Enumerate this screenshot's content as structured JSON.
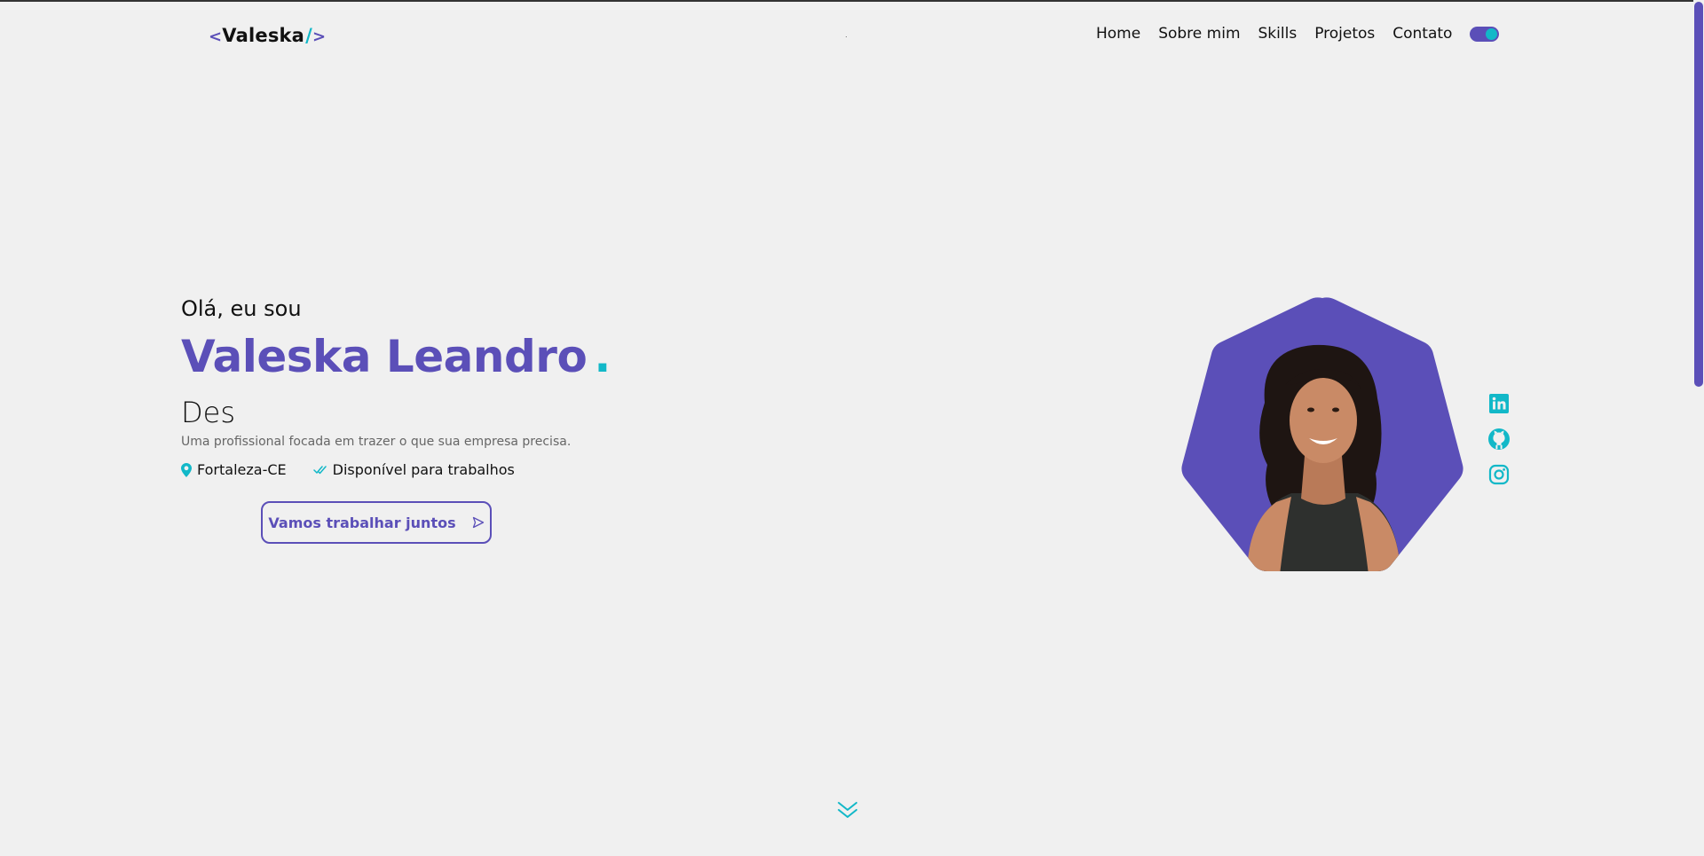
{
  "brand": {
    "open_bracket": "<",
    "name": "Valeska",
    "slash": "/",
    "close_bracket": ">",
    "accent_color": "#5b4fb8",
    "secondary_color": "#12b8c8"
  },
  "nav": {
    "items": [
      {
        "label": "Home"
      },
      {
        "label": "Sobre mim"
      },
      {
        "label": "Skills"
      },
      {
        "label": "Projetos"
      },
      {
        "label": "Contato"
      }
    ],
    "theme_toggle": {
      "state": "on",
      "icon": "toggle-icon"
    }
  },
  "hero": {
    "greeting": "Olá, eu sou",
    "name": "Valeska Leandro",
    "name_dot": ".",
    "role_typed": "Des",
    "tagline": "Uma profissional focada em trazer o que sua empresa precisa.",
    "location": {
      "icon": "map-pin-icon",
      "text": "Fortaleza-CE"
    },
    "availability": {
      "icon": "double-check-icon",
      "text": "Disponível para trabalhos"
    },
    "cta": {
      "label": "Vamos trabalhar juntos",
      "icon": "send-icon"
    }
  },
  "photo": {
    "icon": "profile-photo",
    "background": "#5b4fb8"
  },
  "social": [
    {
      "name": "linkedin",
      "icon": "linkedin-icon"
    },
    {
      "name": "github",
      "icon": "github-icon"
    },
    {
      "name": "instagram",
      "icon": "instagram-icon"
    }
  ],
  "scroll": {
    "icon": "chevrons-down-icon"
  }
}
